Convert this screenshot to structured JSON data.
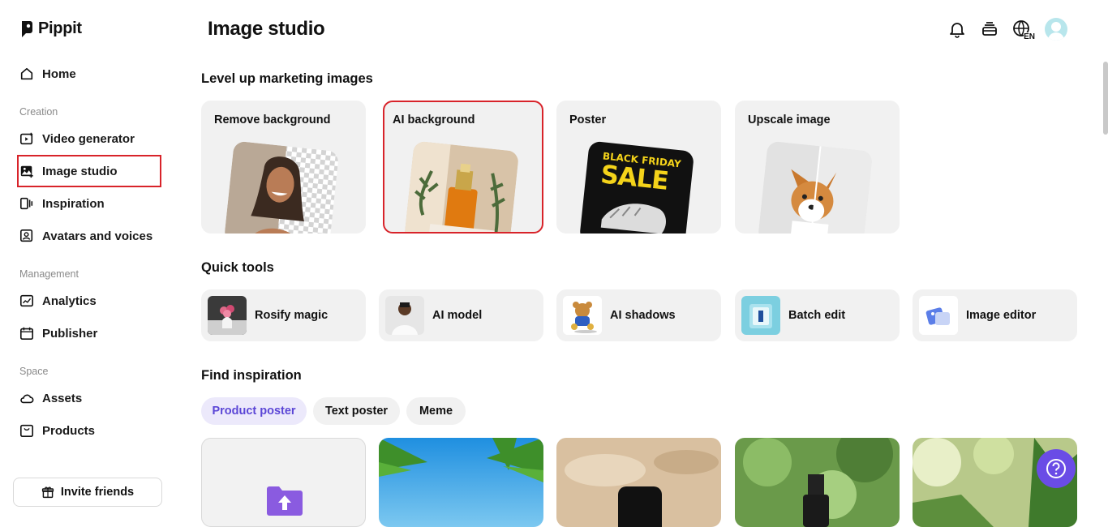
{
  "brand": {
    "name": "Pippit"
  },
  "sidebar": {
    "home": "Home",
    "sections": {
      "creation": "Creation",
      "management": "Management",
      "space": "Space"
    },
    "items": {
      "video_generator": "Video generator",
      "image_studio": "Image studio",
      "inspiration": "Inspiration",
      "avatars": "Avatars and voices",
      "analytics": "Analytics",
      "publisher": "Publisher",
      "assets": "Assets",
      "products": "Products"
    },
    "invite": "Invite friends"
  },
  "header": {
    "title": "Image studio",
    "language": "EN"
  },
  "marketing": {
    "heading": "Level up marketing images",
    "cards": [
      "Remove background",
      "AI background",
      "Poster",
      "Upscale image"
    ],
    "poster_text": {
      "line1": "BLACK FRIDAY",
      "line2": "SALE"
    }
  },
  "quick_tools": {
    "heading": "Quick tools",
    "items": [
      "Rosify magic",
      "AI model",
      "AI shadows",
      "Batch edit",
      "Image editor"
    ]
  },
  "inspiration": {
    "heading": "Find inspiration",
    "chips": [
      "Product poster",
      "Text poster",
      "Meme"
    ],
    "active_chip": "Product poster"
  },
  "colors": {
    "accent": "#6a4ce6",
    "highlight": "#d8232a",
    "card_bg": "#f1f1f1"
  }
}
